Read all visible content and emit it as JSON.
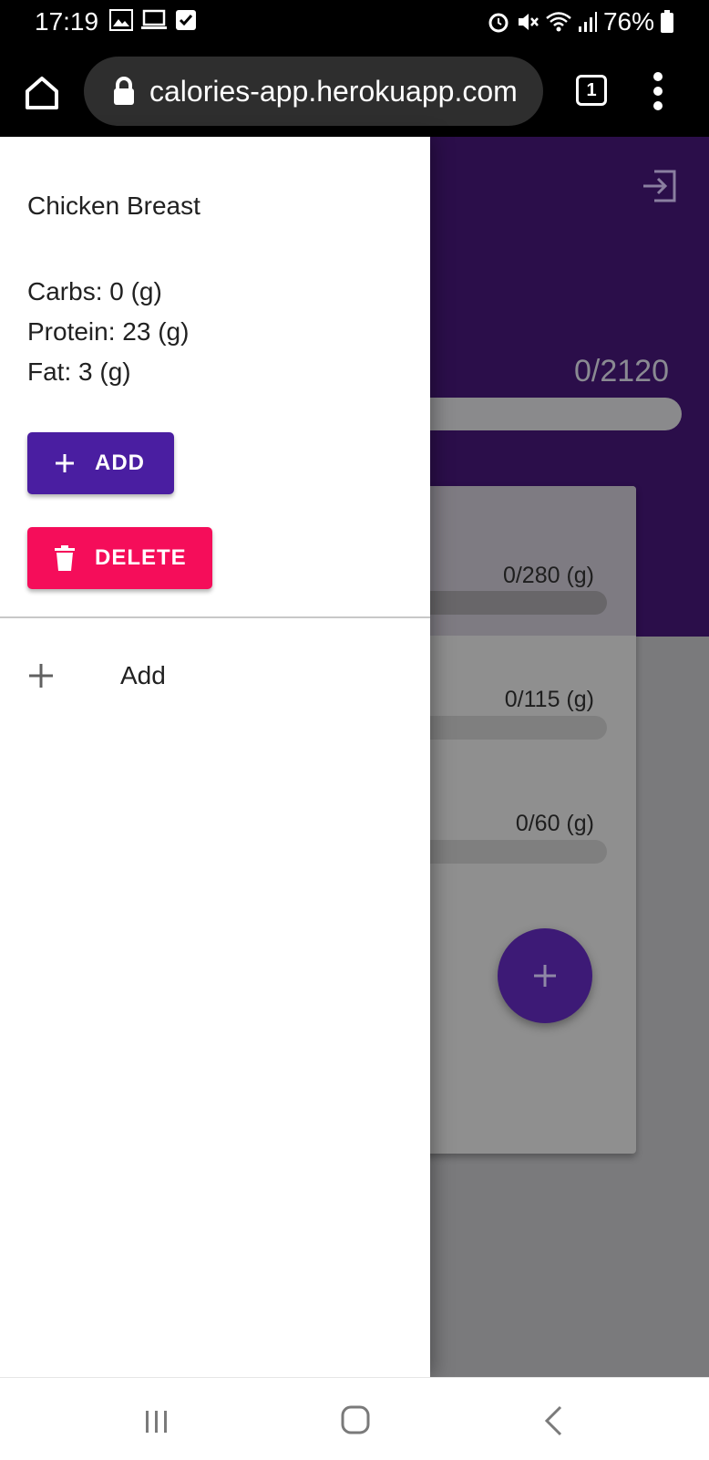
{
  "status_bar": {
    "time": "17:19",
    "battery": "76%"
  },
  "browser": {
    "url": "calories-app.herokuapp.com",
    "tab_count": "1"
  },
  "background_app": {
    "calories": "0/2120",
    "macros": [
      {
        "value": "0/280 (g)"
      },
      {
        "value": "0/115 (g)"
      },
      {
        "value": "0/60 (g)"
      }
    ]
  },
  "drawer": {
    "food_name": "Chicken Breast",
    "carbs": "Carbs: 0 (g)",
    "protein": "Protein: 23 (g)",
    "fat": "Fat: 3 (g)",
    "add_button": "ADD",
    "delete_button": "DELETE",
    "add_item_label": "Add"
  },
  "colors": {
    "primary": "#4a1ea1",
    "danger": "#f50d5a",
    "header": "#2b0e4a"
  }
}
